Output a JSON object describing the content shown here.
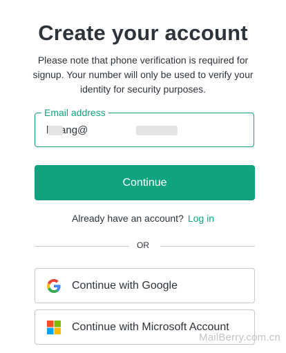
{
  "header": {
    "title": "Create your account",
    "note": "Please note that phone verification is required for signup. Your number will only be used to verify your identity for security purposes."
  },
  "email_field": {
    "label": "Email address",
    "value": "lhuang@"
  },
  "continue_button": {
    "label": "Continue"
  },
  "login_prompt": {
    "text": "Already have an account?",
    "link": "Log in"
  },
  "divider": {
    "text": "OR"
  },
  "social": [
    {
      "label": "Continue with Google",
      "icon": "google-icon"
    },
    {
      "label": "Continue with Microsoft Account",
      "icon": "microsoft-icon"
    }
  ],
  "watermark": "MailBerry.com.cn",
  "colors": {
    "accent": "#10a37f",
    "text": "#2d333a",
    "border": "#c2c8d0"
  }
}
